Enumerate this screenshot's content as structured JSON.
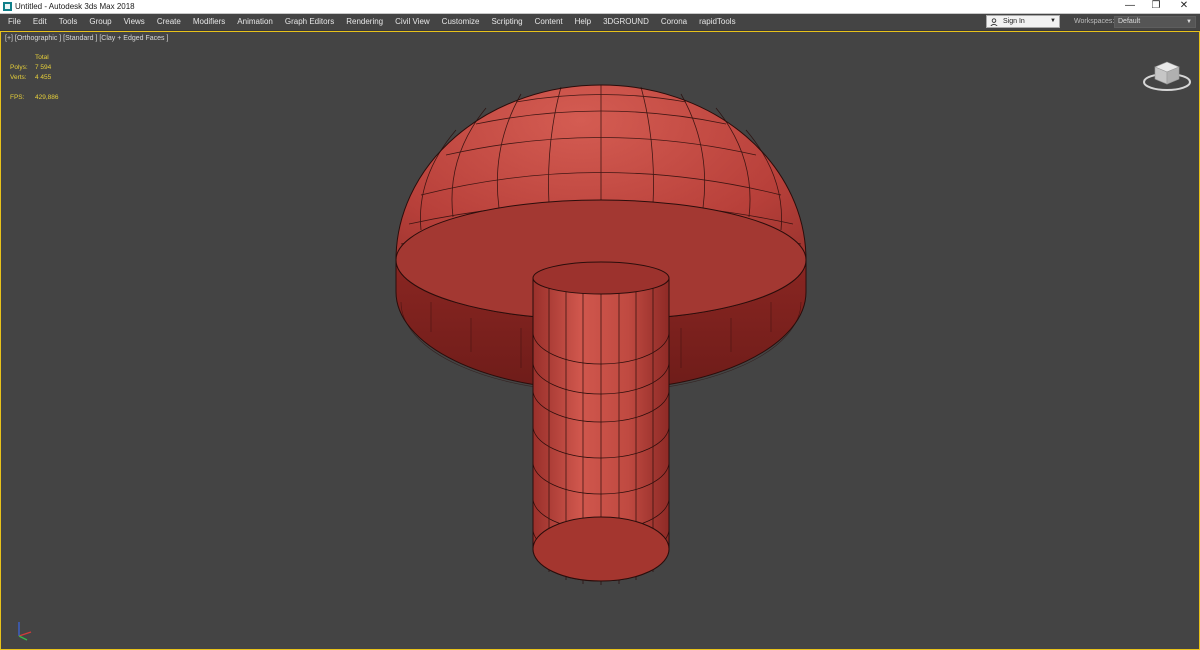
{
  "window": {
    "title": "Untitled - Autodesk 3ds Max 2018",
    "app_icon": "3ds-max-icon",
    "controls": [
      "minimize-icon",
      "restore-icon",
      "close-icon"
    ],
    "control_glyphs": {
      "minimize": "—",
      "restore": "❐",
      "close": "✕"
    }
  },
  "menubar": {
    "items": [
      "File",
      "Edit",
      "Tools",
      "Group",
      "Views",
      "Create",
      "Modifiers",
      "Animation",
      "Graph Editors",
      "Rendering",
      "Civil View",
      "Customize",
      "Scripting",
      "Content",
      "Help",
      "3DGROUND",
      "Corona",
      "rapidTools"
    ],
    "sign_in": {
      "label": "Sign In",
      "icon": "user-icon"
    },
    "workspaces": {
      "label": "Workspaces:",
      "value": "Default"
    }
  },
  "viewport": {
    "label": "[+] [Orthographic ] [Standard ] [Clay + Edged Faces ]",
    "stats": {
      "header": "Total",
      "rows": [
        {
          "key": "Polys:",
          "value": "7 594"
        },
        {
          "key": "Verts:",
          "value": "4 455"
        },
        {
          "key": "FPS:",
          "value": "429,886"
        }
      ]
    },
    "icons": [
      "viewcube-icon",
      "axis-tripod-icon"
    ]
  },
  "colors": {
    "viewport_bg": "#444444",
    "active_border": "#e8c21a",
    "stats_text": "#e6cf3a",
    "clay_color": "#b8403a",
    "edge_color": "#2a0d0b"
  }
}
